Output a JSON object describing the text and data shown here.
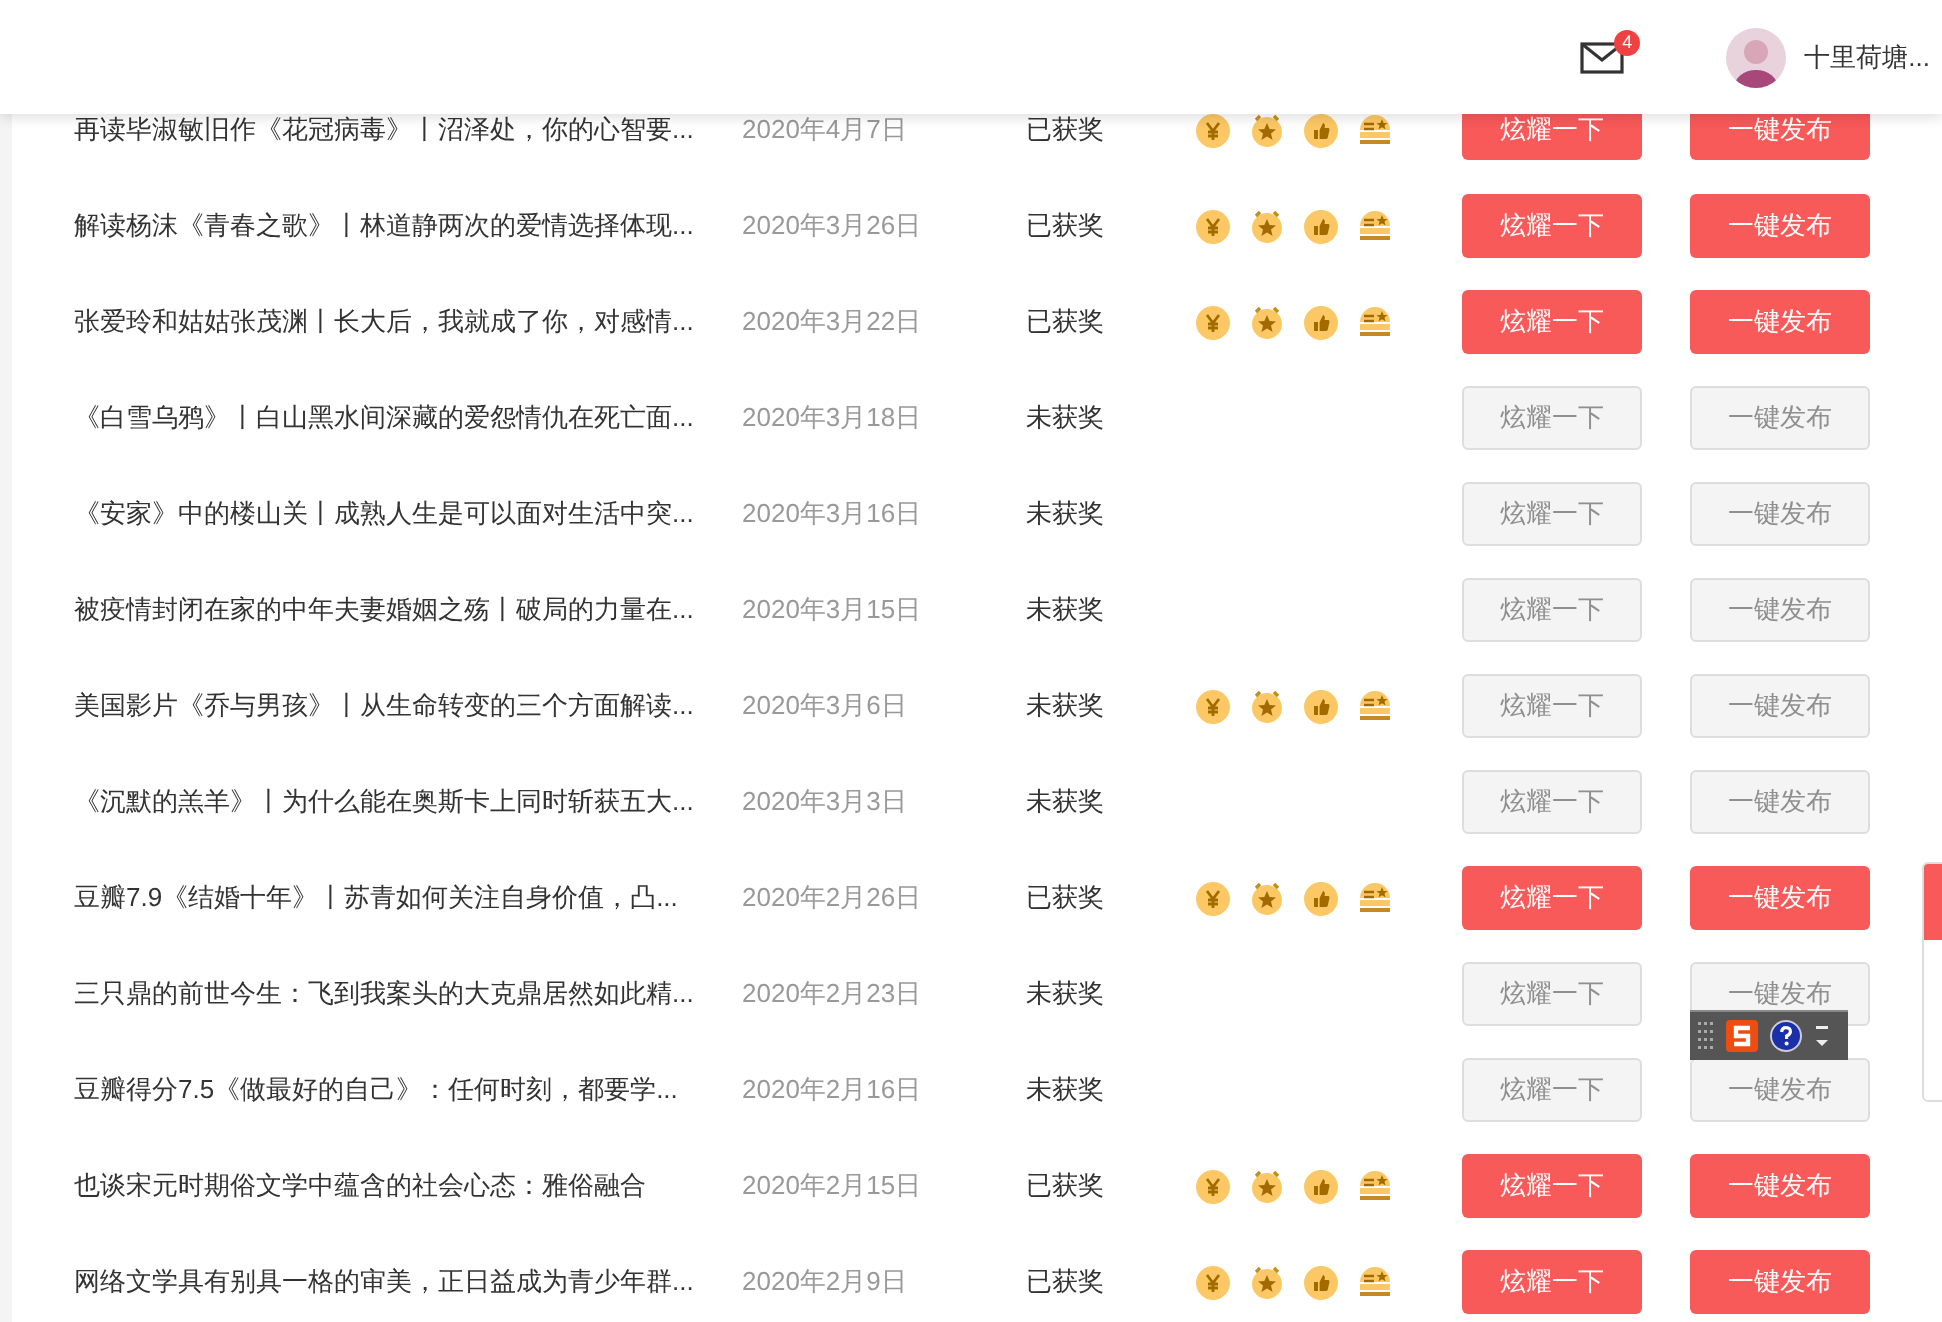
{
  "header": {
    "mail_badge": "4",
    "user_name": "十里荷塘..."
  },
  "rows": [
    {
      "title": "再读毕淑敏旧作《花冠病毒》丨沼泽处，你的心智要...",
      "date": "2020年4月7日",
      "status": "已获奖",
      "badges": true,
      "disabled": false,
      "buttons": [
        "炫耀一下",
        "一键发布"
      ]
    },
    {
      "title": "解读杨沫《青春之歌》丨林道静两次的爱情选择体现...",
      "date": "2020年3月26日",
      "status": "已获奖",
      "badges": true,
      "disabled": false,
      "buttons": [
        "炫耀一下",
        "一键发布"
      ]
    },
    {
      "title": "张爱玲和姑姑张茂渊丨长大后，我就成了你，对感情...",
      "date": "2020年3月22日",
      "status": "已获奖",
      "badges": true,
      "disabled": false,
      "buttons": [
        "炫耀一下",
        "一键发布"
      ]
    },
    {
      "title": "《白雪乌鸦》丨白山黑水间深藏的爱怨情仇在死亡面...",
      "date": "2020年3月18日",
      "status": "未获奖",
      "badges": false,
      "disabled": true,
      "buttons": [
        "炫耀一下",
        "一键发布"
      ]
    },
    {
      "title": "《安家》中的楼山关丨成熟人生是可以面对生活中突...",
      "date": "2020年3月16日",
      "status": "未获奖",
      "badges": false,
      "disabled": true,
      "buttons": [
        "炫耀一下",
        "一键发布"
      ]
    },
    {
      "title": "被疫情封闭在家的中年夫妻婚姻之殇丨破局的力量在...",
      "date": "2020年3月15日",
      "status": "未获奖",
      "badges": false,
      "disabled": true,
      "buttons": [
        "炫耀一下",
        "一键发布"
      ]
    },
    {
      "title": "美国影片《乔与男孩》丨从生命转变的三个方面解读...",
      "date": "2020年3月6日",
      "status": "未获奖",
      "badges": true,
      "disabled": true,
      "buttons": [
        "炫耀一下",
        "一键发布"
      ]
    },
    {
      "title": "《沉默的羔羊》丨为什么能在奥斯卡上同时斩获五大...",
      "date": "2020年3月3日",
      "status": "未获奖",
      "badges": false,
      "disabled": true,
      "buttons": [
        "炫耀一下",
        "一键发布"
      ]
    },
    {
      "title": "豆瓣7.9《结婚十年》丨苏青如何关注自身价值，凸...",
      "date": "2020年2月26日",
      "status": "已获奖",
      "badges": true,
      "disabled": false,
      "buttons": [
        "炫耀一下",
        "一键发布"
      ]
    },
    {
      "title": "三只鼎的前世今生：飞到我案头的大克鼎居然如此精...",
      "date": "2020年2月23日",
      "status": "未获奖",
      "badges": false,
      "disabled": true,
      "buttons": [
        "炫耀一下",
        "一键发布"
      ]
    },
    {
      "title": "豆瓣得分7.5《做最好的自己》：任何时刻，都要学...",
      "date": "2020年2月16日",
      "status": "未获奖",
      "badges": false,
      "disabled": true,
      "buttons": [
        "炫耀一下",
        "一键发布"
      ]
    },
    {
      "title": "也谈宋元时期俗文学中蕴含的社会心态：雅俗融合",
      "date": "2020年2月15日",
      "status": "已获奖",
      "badges": true,
      "disabled": false,
      "buttons": [
        "炫耀一下",
        "一键发布"
      ]
    },
    {
      "title": "网络文学具有别具一格的审美，正日益成为青少年群...",
      "date": "2020年2月9日",
      "status": "已获奖",
      "badges": true,
      "disabled": false,
      "buttons": [
        "炫耀一下",
        "一键发布"
      ]
    }
  ]
}
